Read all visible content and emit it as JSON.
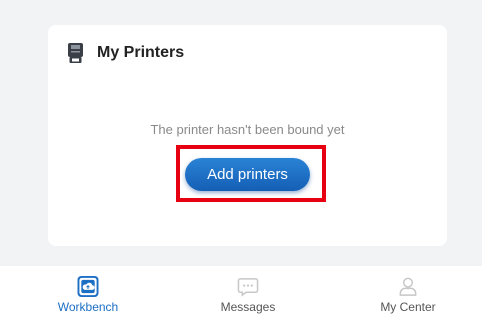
{
  "card": {
    "title": "My Printers",
    "icon": "printer-icon",
    "empty_message": "The printer hasn't been bound yet",
    "add_button_label": "Add printers"
  },
  "highlight_color": "#e60012",
  "tabs": [
    {
      "label": "Workbench",
      "icon": "cloud-icon",
      "active": true
    },
    {
      "label": "Messages",
      "icon": "message-icon",
      "active": false
    },
    {
      "label": "My Center",
      "icon": "user-icon",
      "active": false
    }
  ],
  "colors": {
    "accent": "#1d6fc4",
    "button": "#1a6cc4",
    "inactive_icon": "#c8c8c8"
  }
}
